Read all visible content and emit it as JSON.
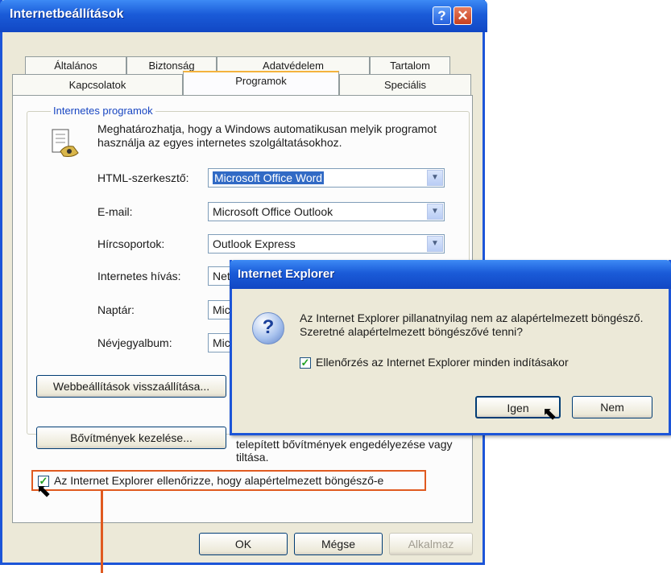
{
  "window": {
    "title": "Internetbeállítások"
  },
  "tabs": {
    "row1": [
      "Általános",
      "Biztonság",
      "Adatvédelem",
      "Tartalom"
    ],
    "row2": [
      "Kapcsolatok",
      "Programok",
      "Speciális"
    ],
    "active": "Programok"
  },
  "programs": {
    "group_label": "Internetes programok",
    "description": "Meghatározhatja, hogy a Windows automatikusan melyik programot használja az egyes internetes szolgáltatásokhoz.",
    "html_editor": {
      "label": "HTML-szerkesztő:",
      "value": "Microsoft Office Word"
    },
    "email": {
      "label": "E-mail:",
      "value": "Microsoft Office Outlook"
    },
    "newsgroups": {
      "label": "Hírcsoportok:",
      "value": "Outlook Express"
    },
    "internet_call": {
      "label": "Internetes hívás:",
      "value": "Net"
    },
    "calendar": {
      "label": "Naptár:",
      "value": "Mic"
    },
    "contacts": {
      "label": "Névjegyalbum:",
      "value": "Mic"
    }
  },
  "buttons": {
    "reset_web": "Webbeállítások visszaállítása...",
    "manage_addons": "Bővítmények kezelése...",
    "ok": "OK",
    "cancel": "Mégse",
    "apply": "Alkalmaz"
  },
  "addons_description": "telepített bővítmények engedélyezése vagy tiltása.",
  "default_check": {
    "label": "Az Internet Explorer ellenőrizze, hogy alapértelmezett böngésző-e",
    "checked": true
  },
  "ie_prompt": {
    "title": "Internet Explorer",
    "message": "Az Internet Explorer pillanatnyilag nem az alapértelmezett böngésző. Szeretné alapértelmezett böngészővé tenni?",
    "check_label": "Ellenőrzés az Internet Explorer minden indításakor",
    "checked": true,
    "yes": "Igen",
    "no": "Nem"
  },
  "colors": {
    "title_bar": "#1a5bd8",
    "highlight": "#e05a20",
    "dialog_bg": "#ece9d8"
  }
}
